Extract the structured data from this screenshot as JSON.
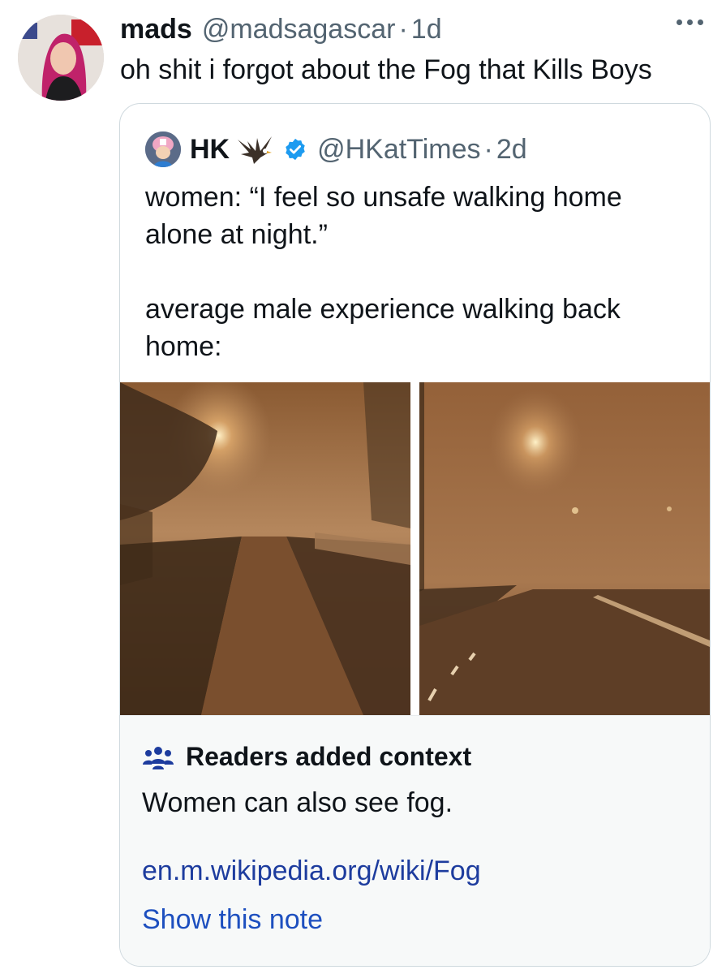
{
  "tweet": {
    "author_name": "mads",
    "author_handle": "@madsagascar",
    "separator": "·",
    "time": "1d",
    "text": "oh shit i forgot about the Fog that Kills Boys",
    "more_icon": "more-horizontal-icon"
  },
  "quoted_tweet": {
    "author_name": "HK",
    "author_handle": "@HKatTimes",
    "separator": "·",
    "time": "2d",
    "text_lines": [
      "women: “I feel so unsafe walking home alone at night.”",
      "average male experience walking back home:"
    ],
    "badge_icon": "verified-badge-icon",
    "emoji_icon": "eagle-icon"
  },
  "media": [
    {
      "alt": "foggy brick walkway at night with trees and street lamp"
    },
    {
      "alt": "foggy road at night with street lamps"
    }
  ],
  "community_note": {
    "title": "Readers added context",
    "body": "Women can also see fog.",
    "link": "en.m.wikipedia.org/wiki/Fog",
    "show_label": "Show this note",
    "icon": "people-icon"
  },
  "colors": {
    "text": "#0f1419",
    "secondary": "#536471",
    "border": "#cfd9de",
    "note_bg": "#f7f9f9",
    "link": "#1d3c9e",
    "verified": "#1d9bf0"
  }
}
